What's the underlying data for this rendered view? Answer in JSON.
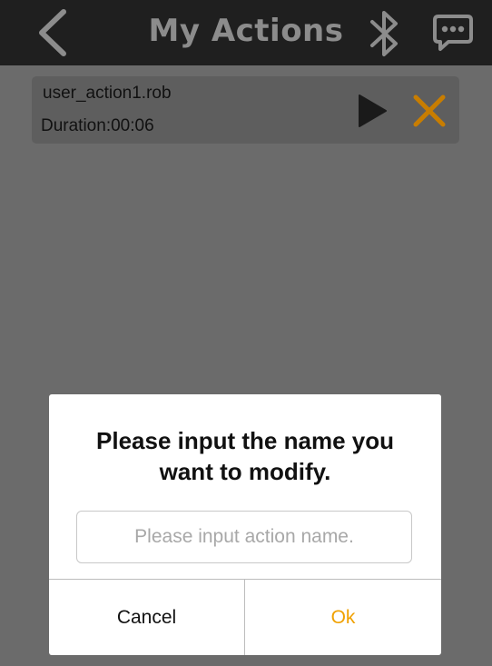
{
  "header": {
    "title": "My Actions",
    "icons": [
      "chevron-left-icon",
      "bluetooth-icon",
      "chat-icon"
    ]
  },
  "actions": [
    {
      "name": "user_action1.rob",
      "duration": "Duration:00:06",
      "icons": [
        "play-icon",
        "close-icon"
      ]
    }
  ],
  "dialog": {
    "title": "Please input the name you want to modify.",
    "input": {
      "value": "",
      "placeholder": "Please input action name."
    },
    "cancel_label": "Cancel",
    "ok_label": "Ok"
  },
  "colors": {
    "topbar_bg": "#1f1f1f",
    "overlay_bg": "#6b6b6b",
    "accent_orange": "#f0a100",
    "delete_icon": "#c87d00"
  }
}
